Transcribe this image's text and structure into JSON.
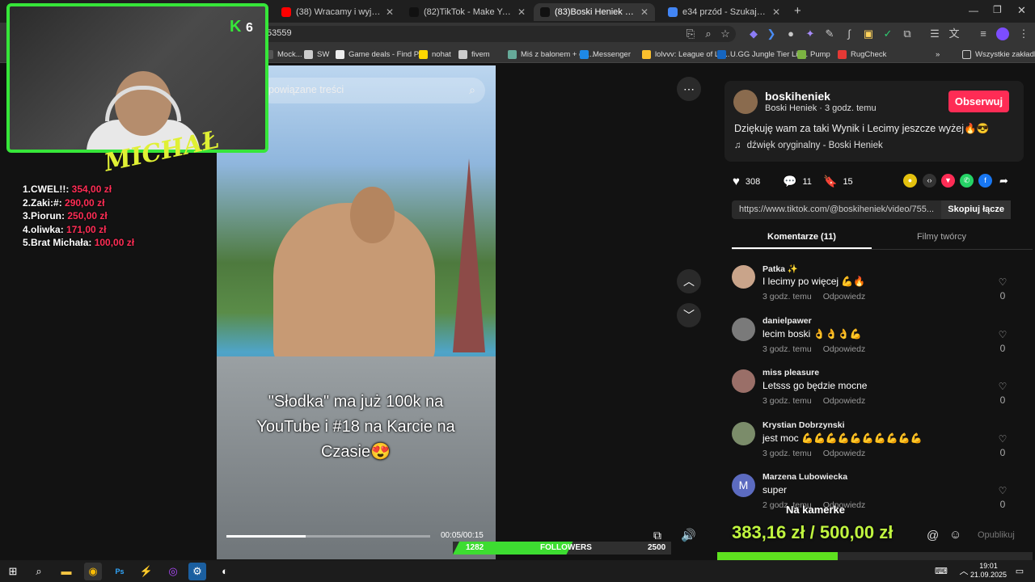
{
  "browser": {
    "tabs": [
      {
        "label": "(38) Wracamy i wyjaśniamy... -",
        "icon": "youtube-icon",
        "color": "#ff0000"
      },
      {
        "label": "(82)TikTok - Make Your Day",
        "icon": "tiktok-icon",
        "color": "#111111"
      },
      {
        "label": "(83)Boski Heniek (@boskih",
        "icon": "tiktok-icon",
        "color": "#111111",
        "active": true
      },
      {
        "label": "e34 przód - Szukaj w Google",
        "icon": "google-icon",
        "color": "#4285f4"
      }
    ],
    "new_tab": "+",
    "url": "53559",
    "bookmarks": [
      {
        "label": "Mock..."
      },
      {
        "label": "SW"
      },
      {
        "label": "Game deals - Find P..."
      },
      {
        "label": "nohat"
      },
      {
        "label": "fivem"
      },
      {
        "label": "Miś z balonem + de..."
      },
      {
        "label": "Messenger"
      },
      {
        "label": "lolvvv: League of Le..."
      },
      {
        "label": "U.GG Jungle Tier Lis..."
      },
      {
        "label": "Pump"
      },
      {
        "label": "RugCheck"
      }
    ],
    "bookmarks_more": "»",
    "all_bookmarks": "Wszystkie zakładki"
  },
  "video": {
    "search_placeholder": "powiązane treści",
    "caption_lines": [
      "\"Słodka\" ma już 100k na",
      "YouTube i #18 na Karcie na",
      "Czasie😍"
    ],
    "time": "00:05/00:15",
    "progress": 0.39
  },
  "post": {
    "username": "boskiheniek",
    "display": "Boski Heniek · 3 godz. temu",
    "follow_label": "Obserwuj",
    "description": "Dziękuję wam za taki Wynik i Lecimy jeszcze wyżej🔥😎",
    "sound": "dźwięk oryginalny - Boski Heniek",
    "likes": "308",
    "comments": "11",
    "saves": "15",
    "link": "https://www.tiktok.com/@boskiheniek/video/755...",
    "copy_label": "Skopiuj łącze",
    "tab_comments": "Komentarze (11)",
    "tab_videos": "Filmy twórcy"
  },
  "comments": [
    {
      "user": "Patka ✨",
      "text": "I lecimy po więcej 💪🔥",
      "time": "3 godz. temu",
      "reply": "Odpowiedz",
      "likes": "0",
      "color": "#c9a48a"
    },
    {
      "user": "danielpawer",
      "text": "lecim boski 👌👌👌💪",
      "time": "3 godz. temu",
      "reply": "Odpowiedz",
      "likes": "0",
      "color": "#7a7a7a"
    },
    {
      "user": "miss pleasure",
      "text": "Letsss go będzie mocne",
      "time": "3 godz. temu",
      "reply": "Odpowiedz",
      "likes": "0",
      "color": "#9a6f68"
    },
    {
      "user": "Krystian Dobrzynski",
      "text": "jest moc 💪💪💪💪💪💪💪💪💪💪",
      "time": "3 godz. temu",
      "reply": "Odpowiedz",
      "likes": "0",
      "color": "#7b8c6a"
    },
    {
      "user": "Marzena Lubowiecka",
      "text": "super",
      "time": "2 godz. temu",
      "reply": "Odpowiedz",
      "likes": "0",
      "color": "#5c6bc0",
      "initial": "M"
    }
  ],
  "comment_input": {
    "publish_label": "Opublikuj"
  },
  "overlay": {
    "kick_count": "6",
    "streamer_logo": "MICHAŁ",
    "donors": [
      {
        "name": "1.CWEL!!:",
        "amount": "354,00 zł"
      },
      {
        "name": "2.Zaki:#:",
        "amount": "290,00 zł"
      },
      {
        "name": "3.Piorun:",
        "amount": "250,00 zł"
      },
      {
        "name": "4.oliwka:",
        "amount": "171,00 zł"
      },
      {
        "name": "5.Brat Michała:",
        "amount": "100,00 zł"
      }
    ],
    "goal_title": "Na kamerke",
    "goal_amount": "383,16 zł / 500,00 zł",
    "goal_progress": 0.766,
    "followers_current": "1282",
    "followers_label": "FOLLOWERS",
    "followers_goal": "2500",
    "followers_progress": 0.513
  },
  "taskbar": {
    "time": "19:01",
    "date": "21.09.2025"
  }
}
